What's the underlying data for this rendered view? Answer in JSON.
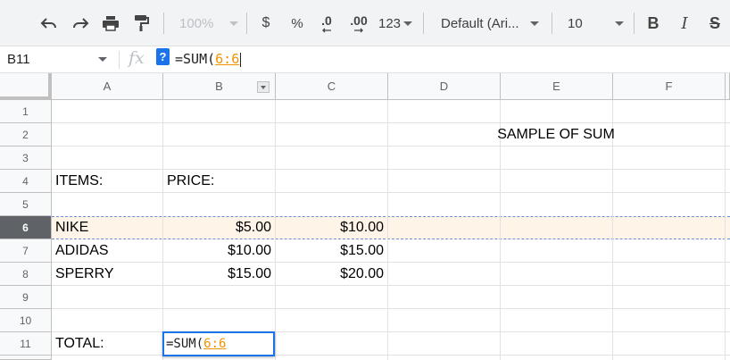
{
  "toolbar": {
    "zoom": "100%",
    "currency": "$",
    "percent": "%",
    "dec_decrease": ".0",
    "dec_increase": ".00",
    "number_format": "123",
    "font": "Default (Ari...",
    "font_size": "10",
    "bold": "B",
    "italic": "I",
    "strike": "S"
  },
  "formula_bar": {
    "cell_ref": "B11",
    "fx": "fx",
    "help": "?",
    "formula_prefix": "=SUM(",
    "formula_ref": "6:6"
  },
  "columns": [
    "A",
    "B",
    "C",
    "D",
    "E",
    "F"
  ],
  "rows": [
    "1",
    "2",
    "3",
    "4",
    "5",
    "6",
    "7",
    "8",
    "9",
    "10",
    "11"
  ],
  "active_row": "6",
  "cells": {
    "title": "SAMPLE OF SUM",
    "items_label": "ITEMS:",
    "price_label": "PRICE:",
    "r6": {
      "a": "NIKE",
      "b": "$5.00",
      "c": "$10.00"
    },
    "r7": {
      "a": "ADIDAS",
      "b": "$10.00",
      "c": "$15.00"
    },
    "r8": {
      "a": "SPERRY",
      "b": "$15.00",
      "c": "$20.00"
    },
    "total_label": "TOTAL:",
    "edit_prefix": "=SUM(",
    "edit_ref": "6:6"
  },
  "colors": {
    "accent": "#1a73e8",
    "reference": "#f09300",
    "row_highlight": "#fef5e8"
  }
}
